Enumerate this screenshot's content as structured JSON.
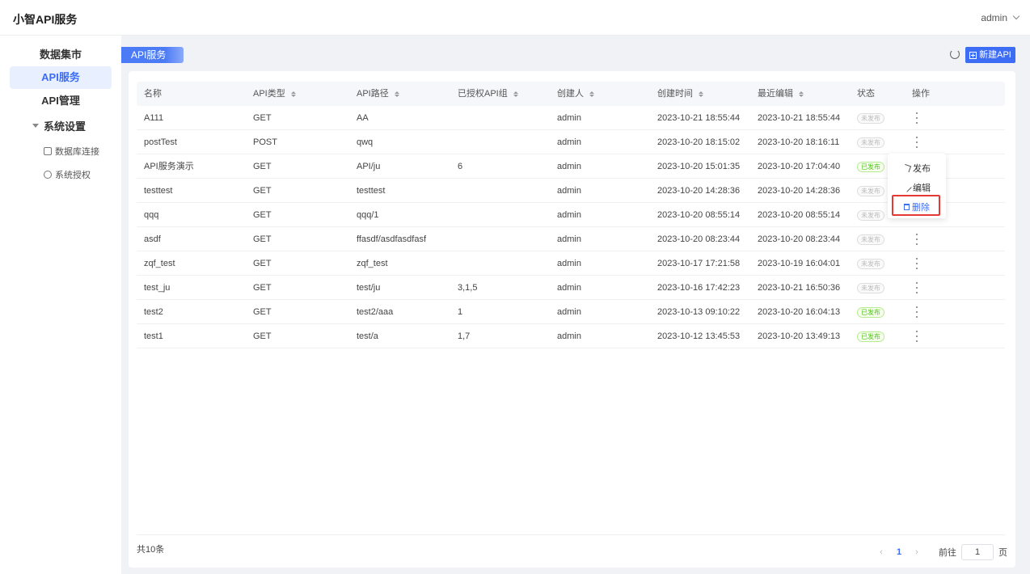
{
  "app": {
    "title": "小智API服务",
    "user": "admin"
  },
  "sidebar": {
    "items": [
      {
        "label": "数据集市"
      },
      {
        "label": "API服务"
      },
      {
        "label": "API管理"
      }
    ],
    "group": {
      "label": "系统设置"
    },
    "sub_items": [
      {
        "label": "数据库连接",
        "icon": "database-icon"
      },
      {
        "label": "系统授权",
        "icon": "network-icon"
      }
    ]
  },
  "breadcrumb": {
    "label": "API服务"
  },
  "toolbar": {
    "refresh_icon": "refresh-icon",
    "new_label": "新建API"
  },
  "table": {
    "columns": [
      "名称",
      "API类型",
      "API路径",
      "已授权API组",
      "创建人",
      "创建时间",
      "最近编辑",
      "状态",
      "操作"
    ],
    "rows": [
      {
        "name": "A111",
        "type": "GET",
        "path": "AA",
        "groups": "",
        "creator": "admin",
        "created": "2023-10-21 18:55:44",
        "edited": "2023-10-21 18:55:44",
        "status": "未发布"
      },
      {
        "name": "postTest",
        "type": "POST",
        "path": "qwq",
        "groups": "",
        "creator": "admin",
        "created": "2023-10-20 18:15:02",
        "edited": "2023-10-20 18:16:11",
        "status": "未发布"
      },
      {
        "name": "API服务演示",
        "type": "GET",
        "path": "API/ju",
        "groups": "6",
        "creator": "admin",
        "created": "2023-10-20 15:01:35",
        "edited": "2023-10-20 17:04:40",
        "status": "已发布"
      },
      {
        "name": "testtest",
        "type": "GET",
        "path": "testtest",
        "groups": "",
        "creator": "admin",
        "created": "2023-10-20 14:28:36",
        "edited": "2023-10-20 14:28:36",
        "status": "未发布"
      },
      {
        "name": "qqq",
        "type": "GET",
        "path": "qqq/1",
        "groups": "",
        "creator": "admin",
        "created": "2023-10-20 08:55:14",
        "edited": "2023-10-20 08:55:14",
        "status": "未发布"
      },
      {
        "name": "asdf",
        "type": "GET",
        "path": "ffasdf/asdfasdfasf",
        "groups": "",
        "creator": "admin",
        "created": "2023-10-20 08:23:44",
        "edited": "2023-10-20 08:23:44",
        "status": "未发布"
      },
      {
        "name": "zqf_test",
        "type": "GET",
        "path": "zqf_test",
        "groups": "",
        "creator": "admin",
        "created": "2023-10-17 17:21:58",
        "edited": "2023-10-19 16:04:01",
        "status": "未发布"
      },
      {
        "name": "test_ju",
        "type": "GET",
        "path": "test/ju",
        "groups": "3,1,5",
        "creator": "admin",
        "created": "2023-10-16 17:42:23",
        "edited": "2023-10-21 16:50:36",
        "status": "未发布"
      },
      {
        "name": "test2",
        "type": "GET",
        "path": "test2/aaa",
        "groups": "1",
        "creator": "admin",
        "created": "2023-10-13 09:10:22",
        "edited": "2023-10-20 16:04:13",
        "status": "已发布"
      },
      {
        "name": "test1",
        "type": "GET",
        "path": "test/a",
        "groups": "1,7",
        "creator": "admin",
        "created": "2023-10-12 13:45:53",
        "edited": "2023-10-20 13:49:13",
        "status": "已发布"
      }
    ]
  },
  "dropdown": {
    "items": [
      {
        "label": "发布",
        "icon": "send-icon"
      },
      {
        "label": "编辑",
        "icon": "edit-icon"
      },
      {
        "label": "删除",
        "icon": "trash-icon"
      }
    ]
  },
  "footer": {
    "total": "共10条",
    "page": "1",
    "goto_label": "前往",
    "page_input": "1",
    "page_suffix": "页"
  },
  "colors": {
    "accent": "#3d6cf5",
    "published": "#52c41a",
    "highlight": "#e53935"
  }
}
